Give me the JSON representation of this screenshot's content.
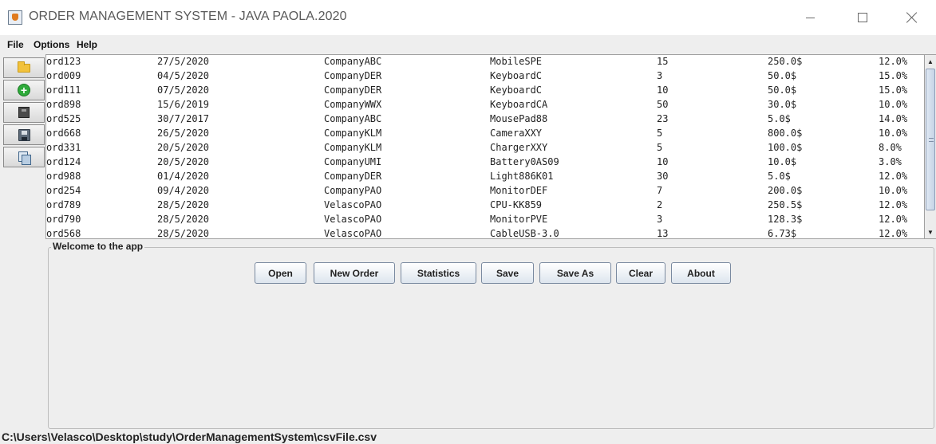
{
  "window": {
    "title": "ORDER MANAGEMENT SYSTEM - JAVA PAOLA.2020",
    "app_icon": "java-cup-icon"
  },
  "menu": [
    "File",
    "Options",
    "Help"
  ],
  "toolbar": {
    "icons": [
      "folder-icon",
      "add-icon",
      "dark-save-icon",
      "save-disk-icon",
      "copy-icon"
    ]
  },
  "table": {
    "rows": [
      [
        "ord123",
        "27/5/2020",
        "CompanyABC",
        "MobileSPE",
        "15",
        "250.0$",
        "12.0%"
      ],
      [
        "ord009",
        "04/5/2020",
        "CompanyDER",
        "KeyboardC",
        "3",
        "50.0$",
        "15.0%"
      ],
      [
        "ord111",
        "07/5/2020",
        "CompanyDER",
        "KeyboardC",
        "10",
        "50.0$",
        "15.0%"
      ],
      [
        "ord898",
        "15/6/2019",
        "CompanyWWX",
        "KeyboardCA",
        "50",
        "30.0$",
        "10.0%"
      ],
      [
        "ord525",
        "30/7/2017",
        "CompanyABC",
        "MousePad88",
        "23",
        "5.0$",
        "14.0%"
      ],
      [
        "ord668",
        "26/5/2020",
        "CompanyKLM",
        "CameraXXY",
        "5",
        "800.0$",
        "10.0%"
      ],
      [
        "ord331",
        "20/5/2020",
        "CompanyKLM",
        "ChargerXXY",
        "5",
        "100.0$",
        "8.0%"
      ],
      [
        "ord124",
        "20/5/2020",
        "CompanyUMI",
        "Battery0AS09",
        "10",
        "10.0$",
        "3.0%"
      ],
      [
        "ord988",
        "01/4/2020",
        "CompanyDER",
        "Light886K01",
        "30",
        "5.0$",
        "12.0%"
      ],
      [
        "ord254",
        "09/4/2020",
        "CompanyPAO",
        "MonitorDEF",
        "7",
        "200.0$",
        "10.0%"
      ],
      [
        "ord789",
        "28/5/2020",
        "VelascoPAO",
        "CPU-KK859",
        "2",
        "250.5$",
        "12.0%"
      ],
      [
        "ord790",
        "28/5/2020",
        "VelascoPAO",
        "MonitorPVE",
        "3",
        "128.3$",
        "12.0%"
      ],
      [
        "ord568",
        "28/5/2020",
        "VelascoPAO",
        "CableUSB-3.0",
        "13",
        "6.73$",
        "12.0%"
      ]
    ]
  },
  "panel": {
    "title": "Welcome to the app",
    "buttons": [
      "Open",
      "New Order",
      "Statistics",
      "Save",
      "Save As",
      "Clear",
      "About"
    ]
  },
  "status": {
    "path": "C:\\Users\\Velasco\\Desktop\\study\\OrderManagementSystem\\csvFile.csv"
  }
}
